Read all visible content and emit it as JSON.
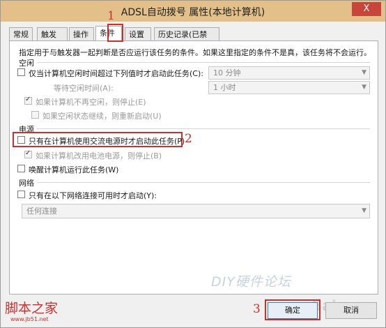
{
  "window": {
    "title": "ADSL自动拨号 属性(本地计算机)",
    "close_glyph": "X"
  },
  "tabs": [
    "常规",
    "触发器",
    "操作",
    "条件",
    "设置",
    "历史记录(已禁用)"
  ],
  "description": "指定用于与触发器一起判断是否应运行该任务的条件。如果这里指定的条件不是真，该任务将不会运行。",
  "idle": {
    "section_label": "空闲",
    "start_only_if_idle": {
      "label": "仅当计算机空闲时间超过下列值时才启动此任务(C):",
      "checked": false,
      "dropdown": "10 分钟"
    },
    "wait_for_idle": {
      "label": "等待空闲时间(A):",
      "dropdown": "1 小时"
    },
    "stop_if_not_idle": {
      "label": "如果计算机不再空闲，则停止(E)",
      "checked": true
    },
    "restart_if_idle_resumes": {
      "label": "如果空闲状态继续，则重新启动(U)",
      "checked": false
    }
  },
  "power": {
    "section_label": "电源",
    "ac_power_only": {
      "label": "只有在计算机使用交流电源时才启动此任务(P)",
      "checked": false
    },
    "stop_on_battery": {
      "label": "如果计算机改用电池电源，则停止(B)",
      "checked": true
    },
    "wake_to_run": {
      "label": "唤醒计算机运行此任务(W)",
      "checked": false
    }
  },
  "network": {
    "section_label": "网络",
    "start_only_if_network": {
      "label": "只有在以下网络连接可用时才启动(Y):",
      "checked": false
    },
    "connection_dropdown": "任何连接"
  },
  "buttons": {
    "ok": "确定",
    "cancel": "取消"
  },
  "annotations": {
    "one": "1",
    "two": "2",
    "three": "3"
  },
  "watermarks": {
    "logo": "脚本之家",
    "url": "www.jb51.net",
    "middle": "DIY硬件论坛",
    "baidu": "Bai"
  },
  "colors": {
    "title_bar": "#e3c08a",
    "close_button": "#c7453a",
    "annotation_red": "#c8322e"
  }
}
